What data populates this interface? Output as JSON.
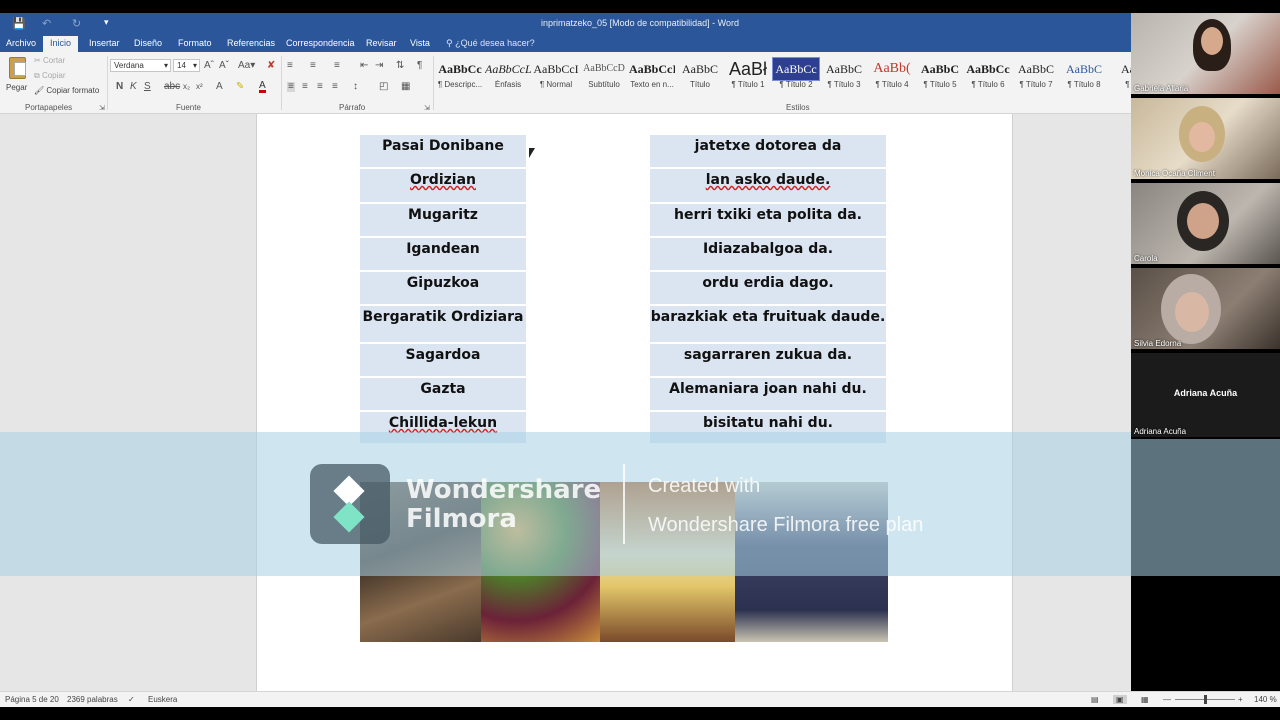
{
  "window": {
    "title": "inprimatzeko_05 [Modo de compatibilidad] - Word"
  },
  "ribbon_tabs": {
    "archivo": "Archivo",
    "inicio": "Inicio",
    "insertar": "Insertar",
    "diseno": "Diseño",
    "formato": "Formato",
    "referencias": "Referencias",
    "correspondencia": "Correspondencia",
    "revisar": "Revisar",
    "vista": "Vista",
    "tell_me": "¿Qué desea hacer?"
  },
  "clipboard": {
    "paste": "Pegar",
    "cut": "Cortar",
    "copy": "Copiar",
    "format_painter": "Copiar formato",
    "label": "Portapapeles"
  },
  "font": {
    "name": "Verdana",
    "size": "14",
    "label": "Fuente",
    "bold": "N",
    "italic": "K",
    "underline": "S",
    "change_case": "Aa"
  },
  "paragraph": {
    "label": "Párrafo"
  },
  "styles": {
    "label": "Estilos",
    "items": [
      {
        "sample": "AaBbCc",
        "name": "¶ Descripc..."
      },
      {
        "sample": "AaBbCcL",
        "name": "Énfasis"
      },
      {
        "sample": "AaBbCcI",
        "name": "¶ Normal"
      },
      {
        "sample": "AaBbCcD",
        "name": "Subtítulo"
      },
      {
        "sample": "AaBbCcI",
        "name": "Texto en n..."
      },
      {
        "sample": "AaBbC",
        "name": "Título"
      },
      {
        "sample": "AaBł",
        "name": "¶ Título 1"
      },
      {
        "sample": "AaBbCc",
        "name": "¶ Título 2"
      },
      {
        "sample": "AaBbC",
        "name": "¶ Título 3"
      },
      {
        "sample": "AaBb(",
        "name": "¶ Título 4"
      },
      {
        "sample": "AaBbC",
        "name": "¶ Título 5"
      },
      {
        "sample": "AaBbCc",
        "name": "¶ Título 6"
      },
      {
        "sample": "AaBbC",
        "name": "¶ Título 7"
      },
      {
        "sample": "AaBbC",
        "name": "¶ Título 8"
      },
      {
        "sample": "AaB",
        "name": "¶ Tí"
      }
    ]
  },
  "document": {
    "left_column": [
      "Pasai Donibane",
      "Ordizian",
      "Mugaritz",
      "Igandean",
      "Gipuzkoa",
      "Bergaratik Ordiziara",
      "Sagardoa",
      "Gazta",
      "Chillida-lekun"
    ],
    "right_column": [
      "jatetxe dotorea da",
      "lan asko daude.",
      "herri txiki eta polita da.",
      "Idiazabalgoa da.",
      "ordu erdia dago.",
      "barazkiak eta fruituak daude.",
      "sagarraren zukua da.",
      "Alemaniara joan nahi du.",
      "bisitatu nahi du."
    ]
  },
  "watermark": {
    "brand_line1": "Wondershare",
    "brand_line2": "Filmora",
    "created_line1": "Created with",
    "created_line2": "Wondershare Filmora free plan"
  },
  "statusbar": {
    "page": "Página 5 de 20",
    "words": "2369 palabras",
    "language": "Euskera",
    "zoom": "140 %"
  },
  "participants": [
    {
      "name": "Gabriela Allaria"
    },
    {
      "name": "Monica Ocaña Climent"
    },
    {
      "name": "Carola"
    },
    {
      "name": "Silvia Edorna"
    },
    {
      "name": "Adriana Acuña"
    }
  ],
  "colors": {
    "word_blue": "#2b579a",
    "cell_fill": "#dbe5f1"
  }
}
